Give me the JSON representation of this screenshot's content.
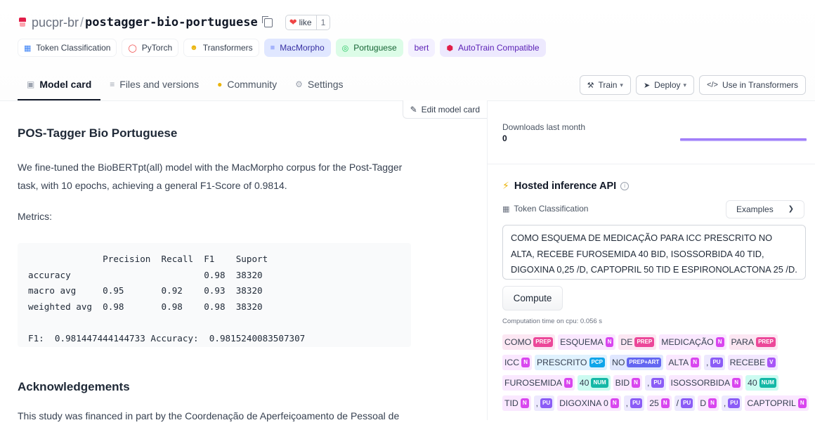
{
  "header": {
    "org": "pucpr-br",
    "slash": "/",
    "model": "postagger-bio-portuguese",
    "like_label": "like",
    "like_count": "1"
  },
  "tags": [
    {
      "label": "Token Classification",
      "icon": "token-classification-icon",
      "style": "plain"
    },
    {
      "label": "PyTorch",
      "icon": "pytorch-icon",
      "style": "plain"
    },
    {
      "label": "Transformers",
      "icon": "hugging-face-icon",
      "style": "plain"
    },
    {
      "label": "MacMorpho",
      "icon": "dataset-icon",
      "style": "indigo"
    },
    {
      "label": "Portuguese",
      "icon": "globe-icon",
      "style": "green"
    },
    {
      "label": "bert",
      "icon": "",
      "style": "plain-purple"
    },
    {
      "label": "AutoTrain Compatible",
      "icon": "autotrain-icon",
      "style": "purple"
    }
  ],
  "tabs": [
    {
      "label": "Model card",
      "icon": "cube-icon",
      "active": true
    },
    {
      "label": "Files and versions",
      "icon": "files-icon",
      "active": false
    },
    {
      "label": "Community",
      "icon": "community-icon",
      "active": false
    },
    {
      "label": "Settings",
      "icon": "gear-icon",
      "active": false
    }
  ],
  "actions": {
    "train": "Train",
    "deploy": "Deploy",
    "use": "Use in Transformers"
  },
  "card": {
    "edit": "Edit model card",
    "title": "POS-Tagger Bio Portuguese",
    "intro_line1": "We fine-tuned the BioBERTpt(all) model with the MacMorpho corpus for the Post-Tagger",
    "intro_line2": "task, with 10 epochs, achieving a general F1-Score of 0.9814.",
    "metrics_label": "Metrics:",
    "metrics_code": "              Precision  Recall  F1    Suport\naccuracy                         0.98  38320\nmacro avg     0.95       0.92    0.93  38320\nweighted avg  0.98       0.98    0.98  38320\n\nF1:  0.981447444144733 Accuracy:  0.9815240083507307",
    "ack_title": "Acknowledgements",
    "ack_text": "This study was financed in part by the Coordenação de Aperfeiçoamento de Pessoal de"
  },
  "sidebar": {
    "downloads_label": "Downloads last month",
    "downloads_value": "0",
    "api_title": "Hosted inference API",
    "task_label": "Token Classification",
    "examples_label": "Examples",
    "input_text": "COMO ESQUEMA DE MEDICAÇÃO PARA ICC PRESCRITO NO ALTA, RECEBE FUROSEMIDA 40 BID, ISOSSORBIDA 40 TID, DIGOXINA 0,25 /D, CAPTOPRIL 50 TID E ESPIRONOLACTONA 25 /D.",
    "compute_label": "Compute",
    "computation_time": "Computation time on cpu: 0.056 s",
    "token_rows": [
      [
        {
          "text": "COMO",
          "label": "PREP",
          "color": "pink"
        },
        {
          "text": "ESQUEMA",
          "label": "N",
          "color": "fuchsia"
        },
        {
          "text": "DE",
          "label": "PREP",
          "color": "pink"
        },
        {
          "text": "MEDICAÇÃO",
          "label": "N",
          "color": "fuchsia"
        },
        {
          "text": "PARA",
          "label": "PREP",
          "color": "pink"
        }
      ],
      [
        {
          "text": "ICC",
          "label": "N",
          "color": "fuchsia"
        },
        {
          "text": "PRESCRITO",
          "label": "PCP",
          "color": "sky"
        },
        {
          "text": "NO",
          "label": "PREP+ART",
          "color": "indigo"
        },
        {
          "text": "ALTA",
          "label": "N",
          "color": "fuchsia"
        },
        {
          "text": ",",
          "label": "PU",
          "color": "violet"
        },
        {
          "text": "RECEBE",
          "label": "V",
          "color": "purple"
        }
      ],
      [
        {
          "text": "FUROSEMIDA",
          "label": "N",
          "color": "fuchsia"
        },
        {
          "text": "40",
          "label": "NUM",
          "color": "teal"
        },
        {
          "text": "BID",
          "label": "N",
          "color": "fuchsia"
        },
        {
          "text": ",",
          "label": "PU",
          "color": "violet"
        },
        {
          "text": "ISOSSORBIDA",
          "label": "N",
          "color": "fuchsia"
        },
        {
          "text": "40",
          "label": "NUM",
          "color": "teal"
        }
      ],
      [
        {
          "text": "TID",
          "label": "N",
          "color": "fuchsia"
        },
        {
          "text": ",",
          "label": "PU",
          "color": "violet"
        },
        {
          "text": "DIGOXINA 0",
          "label": "N",
          "color": "fuchsia"
        },
        {
          "text": ",",
          "label": "PU",
          "color": "violet"
        },
        {
          "text": "25",
          "label": "N",
          "color": "fuchsia"
        },
        {
          "text": "/",
          "label": "PU",
          "color": "violet"
        },
        {
          "text": "D",
          "label": "N",
          "color": "fuchsia"
        },
        {
          "text": ",",
          "label": "PU",
          "color": "violet"
        },
        {
          "text": "CAPTOPRIL",
          "label": "N",
          "color": "fuchsia"
        }
      ]
    ]
  }
}
